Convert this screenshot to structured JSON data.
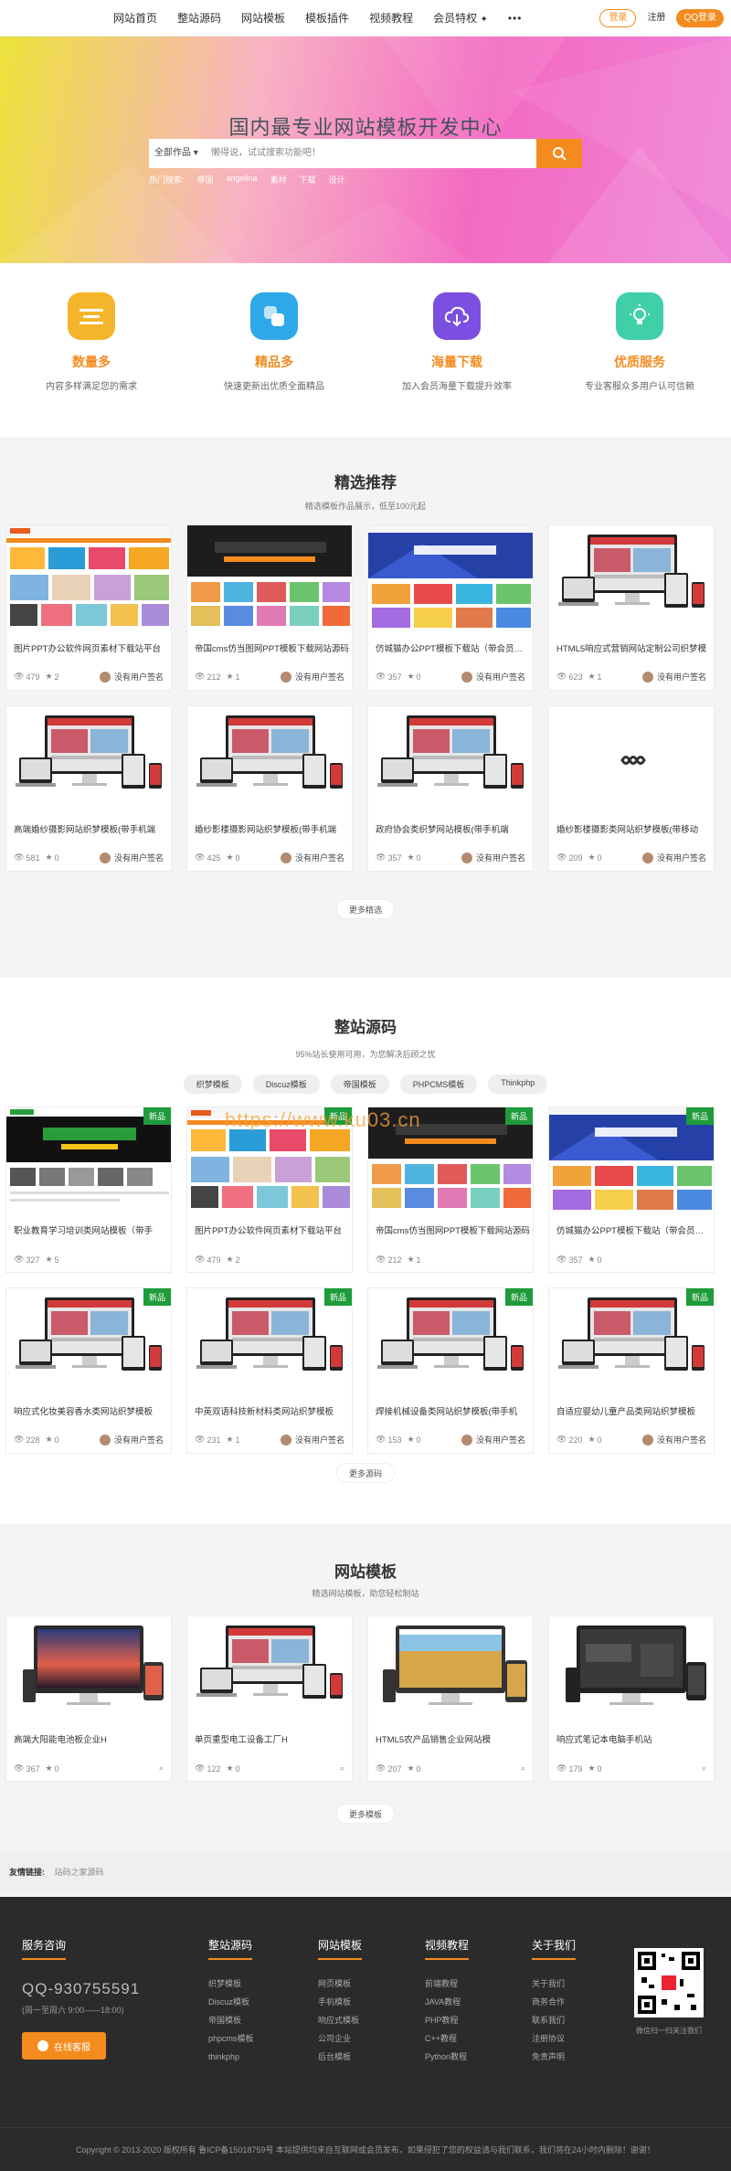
{
  "nav": {
    "items": [
      "网站首页",
      "整站源码",
      "网站模板",
      "模板插件",
      "视频教程"
    ],
    "vip": "会员特权",
    "dots": "•••",
    "login": "登录",
    "register": "注册",
    "qq_login": "QQ登录"
  },
  "hero": {
    "title": "国内最专业网站模板开发中心",
    "category": "全部作品",
    "placeholder": "懒得说，试试搜索功能吧！",
    "hot_label": "热门搜索:",
    "hot": [
      "帝国",
      "angelina",
      "素材",
      "下载",
      "设计"
    ]
  },
  "features": [
    {
      "title": "数量多",
      "desc": "内容多样满足您的需求",
      "color": "#f5b52a"
    },
    {
      "title": "精品多",
      "desc": "快速更新出优质全面精品",
      "color": "#2ea8e9"
    },
    {
      "title": "海量下载",
      "desc": "加入会员海量下载提升效率",
      "color": "#7b4fe0"
    },
    {
      "title": "优质服务",
      "desc": "专业客服众多用户认可信赖",
      "color": "#3fd0a8"
    }
  ],
  "featured": {
    "title": "精选推荐",
    "subtitle": "精选模板作品展示，低至100元起",
    "more": "更多精选",
    "items": [
      {
        "title": "图片PPT办公软件网页素材下载站平台",
        "views": "479",
        "likes": "2",
        "author": "没有用户签名",
        "theme": "orange"
      },
      {
        "title": "帝国cms仿当图网PPT模板下载网站源码",
        "views": "212",
        "likes": "1",
        "author": "没有用户签名",
        "theme": "dark"
      },
      {
        "title": "仿城猫办公PPT模板下载站（带会员…",
        "views": "357",
        "likes": "0",
        "author": "没有用户签名",
        "theme": "blue"
      },
      {
        "title": "HTML5响应式营销网站定制公司织梦模",
        "views": "623",
        "likes": "1",
        "author": "没有用户签名",
        "theme": "device"
      },
      {
        "title": "高端婚纱摄影网站织梦模板(带手机端",
        "views": "581",
        "likes": "0",
        "author": "没有用户签名",
        "theme": "device"
      },
      {
        "title": "婚纱影楼摄影网站织梦模板(带手机端",
        "views": "425",
        "likes": "0",
        "author": "没有用户签名",
        "theme": "device"
      },
      {
        "title": "政府协会类织梦网站模板(带手机端",
        "views": "357",
        "likes": "0",
        "author": "没有用户签名",
        "theme": "device"
      },
      {
        "title": "婚纱影楼摄影类网站织梦模板(带移动",
        "views": "209",
        "likes": "0",
        "author": "没有用户签名",
        "theme": "blank"
      }
    ]
  },
  "source": {
    "title": "整站源码",
    "subtitle": "95%站长使用可用，为您解决后顾之忧",
    "tags": [
      "织梦模板",
      "Discuz模板",
      "帝国模板",
      "PHPCMS模板",
      "Thinkphp"
    ],
    "watermark": "https://www.ku03.cn",
    "badge": "新品",
    "more": "更多源码",
    "items": [
      {
        "title": "职业教育学习培训类网站模板（带手",
        "views": "327",
        "likes": "5",
        "author": "",
        "theme": "green"
      },
      {
        "title": "图片PPT办公软件网页素材下载站平台",
        "views": "479",
        "likes": "2",
        "author": "",
        "theme": "orange"
      },
      {
        "title": "帝国cms仿当图网PPT模板下载网站源码",
        "views": "212",
        "likes": "1",
        "author": "",
        "theme": "dark"
      },
      {
        "title": "仿城猫办公PPT模板下载站（带会员…",
        "views": "357",
        "likes": "0",
        "author": "",
        "theme": "blue"
      },
      {
        "title": "响应式化妆美容香水类网站织梦模板",
        "views": "228",
        "likes": "0",
        "author": "没有用户签名",
        "theme": "device"
      },
      {
        "title": "中英双语科技新材料类网站织梦模板",
        "views": "231",
        "likes": "1",
        "author": "没有用户签名",
        "theme": "device"
      },
      {
        "title": "焊接机械设备类网站织梦模板(带手机",
        "views": "153",
        "likes": "0",
        "author": "没有用户签名",
        "theme": "device"
      },
      {
        "title": "自适应婴幼儿童产品类网站织梦模板",
        "views": "220",
        "likes": "0",
        "author": "没有用户签名",
        "theme": "device"
      }
    ]
  },
  "templates": {
    "title": "网站模板",
    "subtitle": "精选网站模板，助您轻松制站",
    "more": "更多模板",
    "items": [
      {
        "title": "高端大阳能电池板企业H",
        "views": "367",
        "likes": "0",
        "theme": "sunset"
      },
      {
        "title": "单页重型电工设备工厂H",
        "views": "122",
        "likes": "0",
        "theme": "device"
      },
      {
        "title": "HTML5农产品销售企业网站模",
        "views": "207",
        "likes": "0",
        "theme": "field"
      },
      {
        "title": "响应式笔记本电脑手机站",
        "views": "179",
        "likes": "0",
        "theme": "darkdev"
      }
    ]
  },
  "friends": {
    "label": "友情链接:",
    "value": "站码之家源码"
  },
  "footer": {
    "service_title": "服务咨询",
    "qq": "QQ-930755591",
    "hours": "(周一至周六 9:00——18:00)",
    "online": "在线客服",
    "qr_caption": "微信扫一扫关注我们",
    "cols": [
      {
        "title": "整站源码",
        "items": [
          "织梦模板",
          "Discuz模板",
          "帝国模板",
          "phpcms模板",
          "thinkphp"
        ]
      },
      {
        "title": "网站模板",
        "items": [
          "网页模板",
          "手机模板",
          "响应式模板",
          "公司企业",
          "后台模板"
        ]
      },
      {
        "title": "视频教程",
        "items": [
          "前端教程",
          "JAVA教程",
          "PHP教程",
          "C++教程",
          "Python教程"
        ]
      },
      {
        "title": "关于我们",
        "items": [
          "关于我们",
          "商务合作",
          "联系我们",
          "注册协议",
          "免责声明"
        ]
      }
    ],
    "copyright": "Copyright © 2013-2020 版权所有 鲁ICP备15018759号 本站提供均来自互联网或会员发布，如果侵犯了您的权益请与我们联系，我们将在24小时内删除！谢谢！"
  }
}
